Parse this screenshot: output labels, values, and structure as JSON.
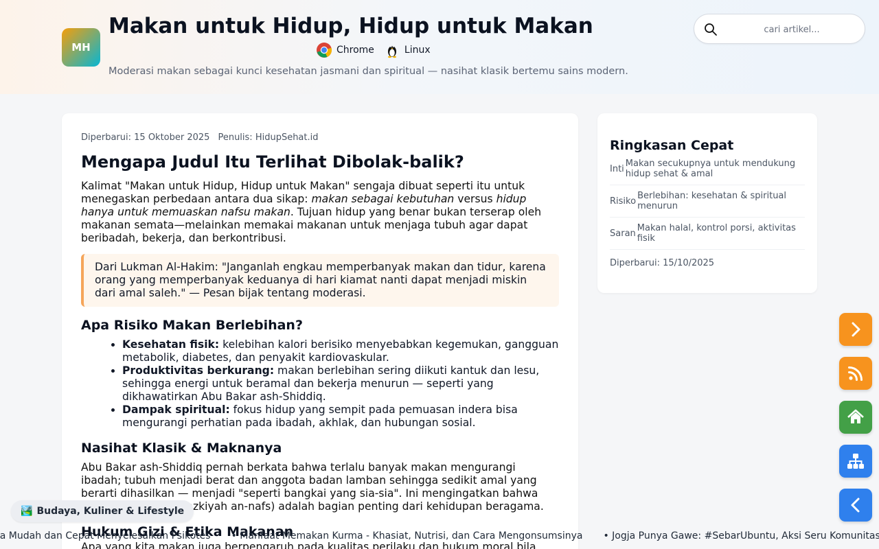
{
  "header": {
    "logo_text": "MH",
    "title": "Makan untuk Hidup, Hidup untuk Makan",
    "env": [
      {
        "label": "Chrome",
        "icon": "chrome-icon"
      },
      {
        "label": "Linux",
        "icon": "linux-tux-icon"
      }
    ],
    "tagline": "Moderasi makan sebagai kunci kesehatan jasmani dan spiritual — nasihat klasik bertemu sains modern.",
    "search_placeholder": "cari artikel..."
  },
  "article": {
    "updated": "Diperbarui: 15 Oktober 2025",
    "author": "Penulis: HidupSehat.id",
    "heading": "Mengapa Judul Itu Terlihat Dibolak-balik?",
    "intro_a": "Kalimat \"Makan untuk Hidup, Hidup untuk Makan\" sengaja dibuat seperti itu untuk menegaskan perbedaan antara dua sikap: ",
    "intro_em1": "makan sebagai kebutuhan",
    "intro_b": " versus ",
    "intro_em2": "hidup hanya untuk memuaskan nafsu makan",
    "intro_c": ". Tujuan hidup yang benar bukan terserap oleh makanan semata—melainkan memakai makanan untuk menjaga tubuh agar dapat beribadah, bekerja, dan berkontribusi.",
    "quote": "Dari Lukman Al-Hakim: \"Janganlah engkau memperbanyak makan dan tidur, karena orang yang memperbanyak keduanya di hari kiamat nanti dapat menjadi miskin dari amal saleh.\" — Pesan bijak tentang moderasi.",
    "risk_heading": "Apa Risiko Makan Berlebihan?",
    "risks": [
      {
        "title": "Kesehatan fisik:",
        "text": " kelebihan kalori berisiko menyebabkan kegemukan, gangguan metabolik, diabetes, dan penyakit kardiovaskular."
      },
      {
        "title": "Produktivitas berkurang:",
        "text": " makan berlebihan sering diikuti kantuk dan lesu, sehingga energi untuk beramal dan bekerja menurun — seperti yang dikhawatirkan Abu Bakar ash-Shiddiq."
      },
      {
        "title": "Dampak spiritual:",
        "text": " fokus hidup yang sempit pada pemuasan indera bisa mengurangi perhatian pada ibadah, akhlak, dan hubungan sosial."
      }
    ],
    "advice_heading": "Nasihat Klasik & Maknanya",
    "advice_text": "Abu Bakar ash-Shiddiq pernah berkata bahwa terlalu banyak makan mengurangi ibadah; tubuh menjadi berat dan anggota badan lamban sehingga sedikit amal yang berarti dihasilkan — menjadi \"seperti bangkai yang sia-sia\". Ini mengingatkan bahwa pengendalian diri (tazkiyah an-nafs) adalah bagian penting dari kehidupan beragama.",
    "law_heading": "Hukum Gizi & Etika Makanan",
    "law_text": "Apa yang kita makan juga berpengaruh pada kualitas perilaku dan hukum moral bila"
  },
  "summary": {
    "title": "Ringkasan Cepat",
    "rows": [
      {
        "key": "Inti",
        "value": "Makan secukupnya untuk mendukung hidup sehat & amal"
      },
      {
        "key": "Risiko",
        "value": "Berlebihan: kesehatan & spiritual menurun"
      },
      {
        "key": "Saran",
        "value": "Makan halal, kontrol porsi, aktivitas fisik"
      }
    ],
    "updated": "Diperbarui: 15/10/2025"
  },
  "fabs": [
    {
      "name": "next-button",
      "icon": "chevron-right-icon",
      "color": "#f7931e"
    },
    {
      "name": "rss-button",
      "icon": "rss-icon",
      "color": "#f7931e"
    },
    {
      "name": "home-button",
      "icon": "home-icon",
      "color": "#43a047"
    },
    {
      "name": "sitemap-button",
      "icon": "sitemap-icon",
      "color": "#2f80ed"
    },
    {
      "name": "back-button",
      "icon": "chevron-left-icon",
      "color": "#2f80ed"
    }
  ],
  "category": {
    "emoji": "🏞️",
    "label": "Budaya, Kuliner & Lifestyle"
  },
  "ticker": [
    "ra Mudah dan Cepat Menyelesaikan Psikotes",
    "Manfaat Memakan Kurma - Khasiat, Nutrisi, dan Cara Mengonsumsinya",
    "Jogja Punya Gawe: #SebarUbuntu, Aksi Seru Komunitas U"
  ]
}
